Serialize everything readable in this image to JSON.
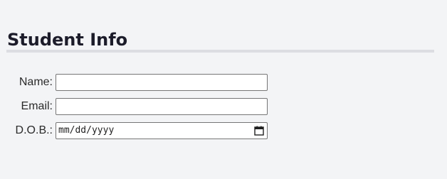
{
  "page": {
    "title": "Student Info"
  },
  "form": {
    "fields": [
      {
        "label": "Name:",
        "type": "text",
        "value": "",
        "placeholder": ""
      },
      {
        "label": "Email:",
        "type": "email",
        "value": "",
        "placeholder": ""
      },
      {
        "label": "D.O.B.:",
        "type": "date",
        "value": "",
        "placeholder": "mm/dd/yyyy",
        "icon": "calendar-icon"
      }
    ]
  },
  "colors": {
    "background": "#f3f4f6",
    "title": "#1c1c2a",
    "rule": "#dcdde2",
    "input_border": "#767676"
  }
}
